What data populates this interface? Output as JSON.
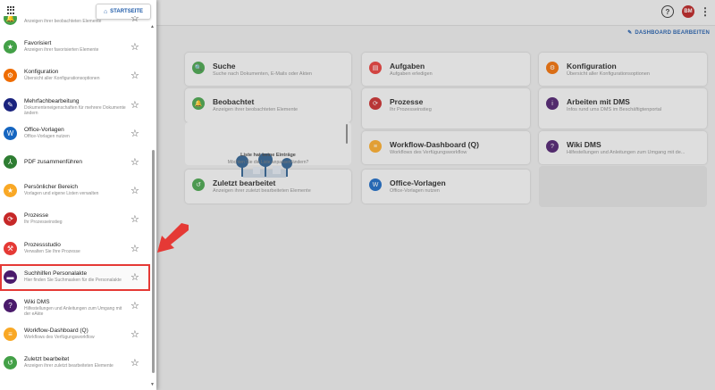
{
  "header": {
    "avatar_initials": "BM"
  },
  "dashboard": {
    "edit_label": "DASHBOARD BEARBEITEN",
    "cards": [
      {
        "title": "Suche",
        "sub": "Suche nach Dokumenten, E-Mails oder Akten",
        "color": "#43a047",
        "icon": "search-icon",
        "glyph": "🔍"
      },
      {
        "title": "Aufgaben",
        "sub": "Aufgaben erledigen",
        "color": "#e53935",
        "icon": "clipboard-icon",
        "glyph": "▤"
      },
      {
        "title": "Konfiguration",
        "sub": "Übersicht aller Konfigurationsoptionen",
        "color": "#ef6c00",
        "icon": "gear-icon",
        "glyph": "⚙"
      },
      {
        "title": "Beobachtet",
        "sub": "Anzeigen ihrer beobachteten Elemente",
        "color": "#43a047",
        "icon": "bell-icon",
        "glyph": "🔔"
      },
      {
        "title": "Prozesse",
        "sub": "Ihr Prozesseinstieg",
        "color": "#c62828",
        "icon": "process-icon",
        "glyph": "⟳"
      },
      {
        "title": "Arbeiten mit DMS",
        "sub": "Infos rund ums DMS im Beschäftigtenportal",
        "color": "#4a1a6b",
        "icon": "info-icon",
        "glyph": "i"
      },
      {
        "title": "Workflow-Dashboard (Q)",
        "sub": "Workflows des Verfügungsworkflow",
        "color": "#f9a825",
        "icon": "list-icon",
        "glyph": "≡"
      },
      {
        "title": "Wiki DMS",
        "sub": "Hilfestellungen und Anleitungen zum Umgang mit de...",
        "color": "#4a1a6b",
        "icon": "help-icon",
        "glyph": "?"
      },
      {
        "title": "Zuletzt bearbeitet",
        "sub": "Anzeigen ihrer zuletzt bearbeiteten Elemente",
        "color": "#43a047",
        "icon": "history-icon",
        "glyph": "↺"
      },
      {
        "title": "Office-Vorlagen",
        "sub": "Office-Vorlagen nutzen",
        "color": "#1565c0",
        "icon": "office-icon",
        "glyph": "W"
      }
    ],
    "empty_list": {
      "title": "Liste hat keine Einträge",
      "sub": "Möchten Sie die Liste anpassen/ändern?"
    }
  },
  "drawer": {
    "home_label": "STARTSEITE",
    "items": [
      {
        "title": "Beobachtet",
        "sub": "Anzeigen ihrer beobachteten Elemente",
        "color": "#43a047",
        "icon": "bell-icon",
        "glyph": "🔔"
      },
      {
        "title": "Favorisiert",
        "sub": "Anzeigen ihrer favorisierten Elemente",
        "color": "#43a047",
        "icon": "star-icon",
        "glyph": "★"
      },
      {
        "title": "Konfiguration",
        "sub": "Übersicht aller Konfigurationsoptionen",
        "color": "#ef6c00",
        "icon": "gear-icon",
        "glyph": "⚙"
      },
      {
        "title": "Mehrfachbearbeitung",
        "sub": "Dokumenteneigenschaften für mehrere Dokumente ändern",
        "color": "#1a237e",
        "icon": "multi-edit-icon",
        "glyph": "✎"
      },
      {
        "title": "Office-Vorlagen",
        "sub": "Office-Vorlagen nutzen",
        "color": "#1565c0",
        "icon": "office-icon",
        "glyph": "W"
      },
      {
        "title": "PDF zusammenführen",
        "sub": "",
        "color": "#2e7d32",
        "icon": "merge-icon",
        "glyph": "⅄"
      },
      {
        "title": "Persönlicher Bereich",
        "sub": "Vorlagen und eigene Listen verwalten",
        "color": "#f9a825",
        "icon": "star-icon",
        "glyph": "★"
      },
      {
        "title": "Prozesse",
        "sub": "Ihr Prozesseinstieg",
        "color": "#c62828",
        "icon": "process-icon",
        "glyph": "⟳"
      },
      {
        "title": "Prozessstudio",
        "sub": "Verwalten Sie Ihre Prozesse",
        "color": "#e53935",
        "icon": "studio-icon",
        "glyph": "⚒"
      },
      {
        "title": "Suchhilfen Personalakte",
        "sub": "Hier finden Sie Suchmasken für die Personalakte",
        "color": "#4a1a6b",
        "icon": "folder-icon",
        "glyph": "▬"
      },
      {
        "title": "Wiki DMS",
        "sub": "Hilfestellungen und Anleitungen zum Umgang mit der eAkte",
        "color": "#4a1a6b",
        "icon": "help-icon",
        "glyph": "?"
      },
      {
        "title": "Workflow-Dashboard (Q)",
        "sub": "Workflows des Verfügungsworkflow",
        "color": "#f9a825",
        "icon": "list-icon",
        "glyph": "≡"
      },
      {
        "title": "Zuletzt bearbeitet",
        "sub": "Anzeigen ihrer zuletzt bearbeiteten Elemente",
        "color": "#43a047",
        "icon": "history-icon",
        "glyph": "↺"
      }
    ]
  }
}
